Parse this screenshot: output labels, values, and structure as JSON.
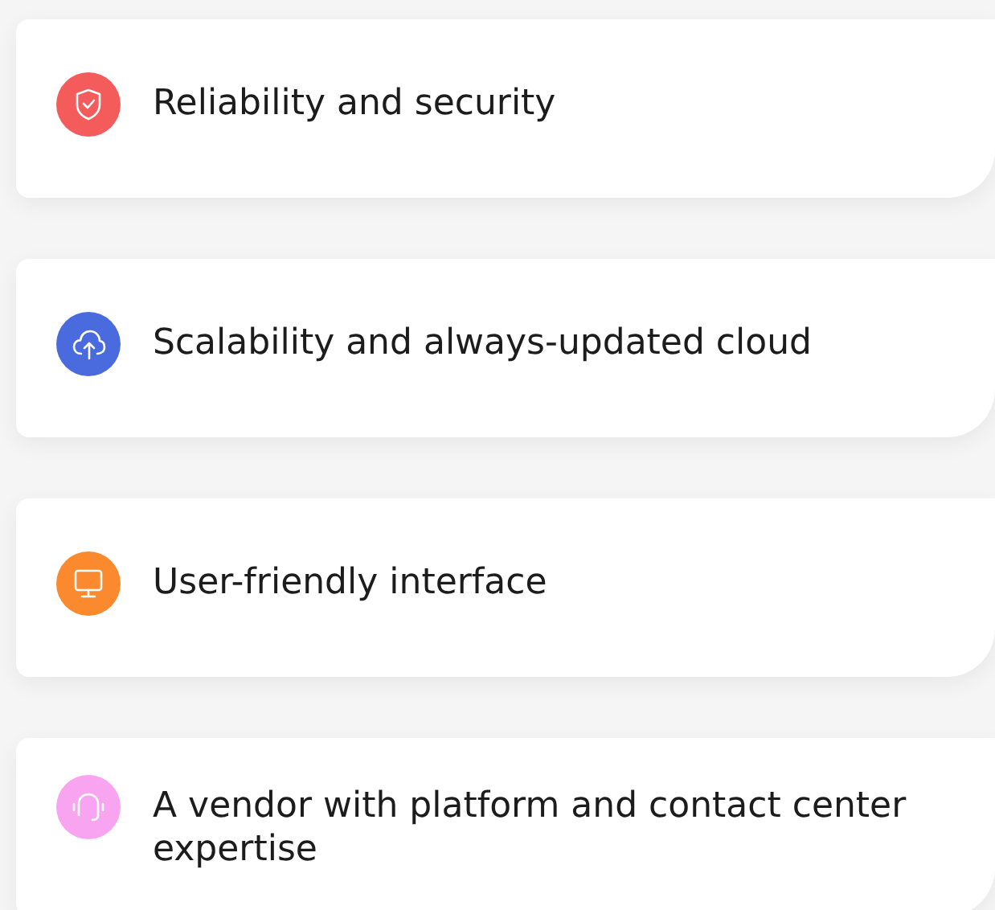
{
  "features": [
    {
      "kind": "shield",
      "color": "#f45b5b",
      "label": "Reliability and security"
    },
    {
      "kind": "cloud",
      "color": "#4a6bde",
      "label": "Scalability and always-updated cloud"
    },
    {
      "kind": "monitor",
      "color": "#fb8a2e",
      "label": "User-friendly interface"
    },
    {
      "kind": "headset",
      "color": "#f9a4f0",
      "label": "A vendor with platform and contact center expertise"
    }
  ]
}
